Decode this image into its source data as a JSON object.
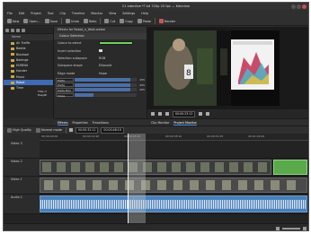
{
  "window": {
    "title": "21 kdenlive *? kd 720p 25 fps — Kdenlive"
  },
  "menu": [
    "File",
    "Edit",
    "Project",
    "Tool",
    "Clip",
    "Timeline",
    "Monitor",
    "View",
    "Settings",
    "Help"
  ],
  "toolbar": {
    "new": "New",
    "open": "Open...",
    "save": "Save",
    "undo": "Undo",
    "redo": "Redo",
    "cut": "Cut",
    "copy": "Copy",
    "paste": "Paste",
    "render": "Render"
  },
  "bin": {
    "header": "Name",
    "items": [
      "Air Traffic",
      "Beetle",
      "Bioshool",
      "Boeinge",
      "EDRE00",
      "Honder",
      "Music",
      "Robot",
      "Time"
    ],
    "selected_index": 7,
    "side_labels": [
      "Title cl",
      "EasyBr"
    ]
  },
  "effects": {
    "header": "Effects for Robot_n_Walk.webm",
    "sub": "Colour Selection",
    "rows": [
      {
        "label": "Colour to select",
        "value": ""
      },
      {
        "label": "Invert selection",
        "value": ""
      },
      {
        "label": "Selection subspace",
        "value": "RGB"
      },
      {
        "label": "Subspace shape",
        "value": "Ellipsoid"
      },
      {
        "label": "Edge mode",
        "value": "Hope"
      }
    ],
    "sliders": [
      {
        "label": "Delta R/A/H",
        "value": "255",
        "fill": 0.9
      },
      {
        "label": "Delta G/B/Chroma",
        "value": "255",
        "fill": 0.9
      },
      {
        "label": "Delta B/I/I",
        "value": "255",
        "fill": 0.9
      },
      {
        "label": "Slope",
        "value": "",
        "fill": 0.3
      }
    ]
  },
  "left_tabs": [
    "Effects",
    "Properties",
    "Transitions"
  ],
  "monitor_tabs": [
    "Clip Monitor",
    "Project Monitor"
  ],
  "monitor": {
    "timecode": "00:00:23:12",
    "tc2": "00:00:00:00"
  },
  "timeline_toolbar": {
    "quality": "High Quality",
    "mode": "Normal mode",
    "tc1": "00:00:32:11",
    "tc2": "00:00:46:19"
  },
  "ruler": [
    "00:00:00:00",
    "00:00:12:20",
    "00:00:25:15",
    "00:00:38:10",
    "00:00:51:05",
    "00:01:04:00",
    "00:01:16:20"
  ],
  "tracks": [
    "Video 3",
    "Video 2",
    "Video 1",
    "Audio 1"
  ],
  "colors": {
    "accent": "#3e6bb3",
    "audio": "#4a7eb8",
    "green": "#5aa94b"
  }
}
